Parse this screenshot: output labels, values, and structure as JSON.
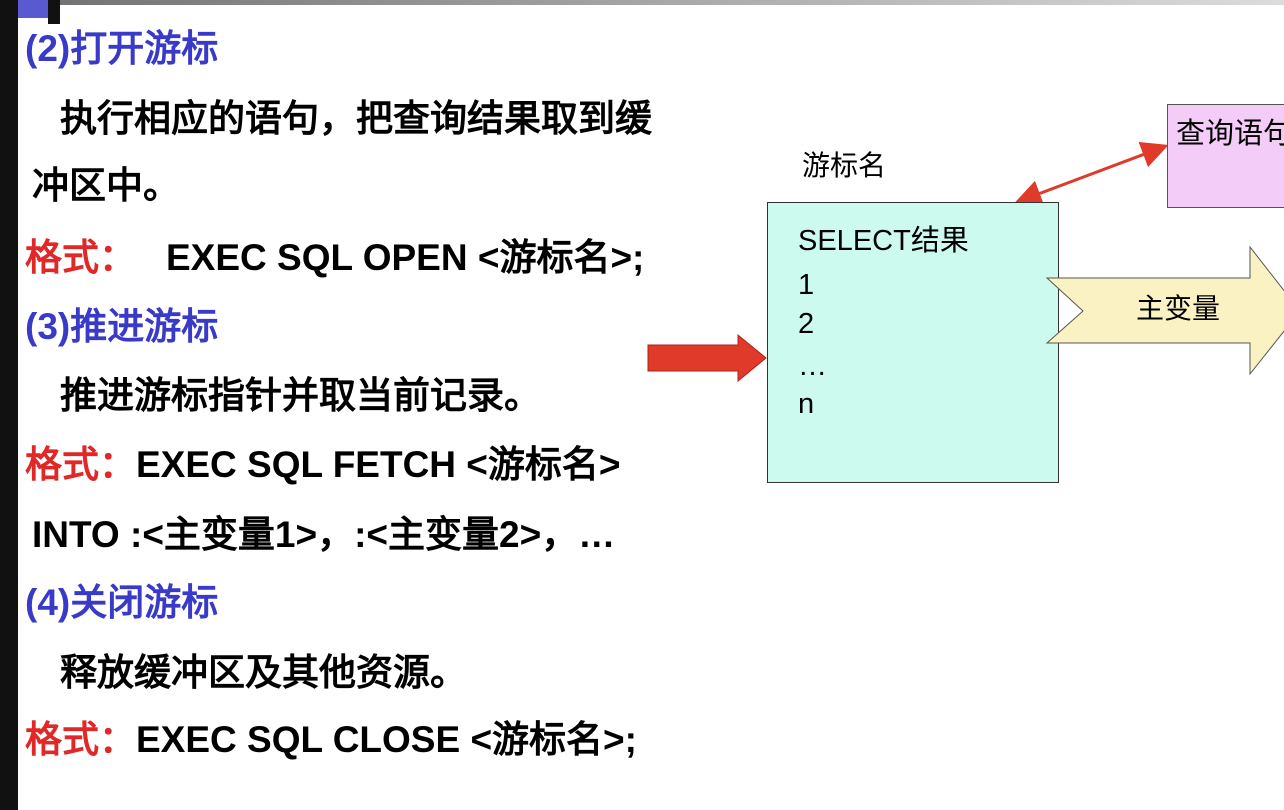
{
  "sections": [
    {
      "heading": "(2)打开游标",
      "desc_line1": "执行相应的语句，把查询结果取到缓",
      "desc_line2": "冲区中。",
      "format_label": "格式：",
      "format_code": "EXEC SQL OPEN <游标名>;"
    },
    {
      "heading": "(3)推进游标",
      "desc": "推进游标指针并取当前记录。",
      "format_label": "格式：",
      "format_code": "EXEC SQL FETCH <游标名>",
      "format_code_2": "INTO :<主变量1>，:<主变量2>，…"
    },
    {
      "heading": "(4)关闭游标",
      "desc": "释放缓冲区及其他资源。",
      "format_label": "格式：",
      "format_code": "EXEC SQL CLOSE <游标名>;"
    }
  ],
  "diagram": {
    "cursor_label": "游标名",
    "result_title": "SELECT结果",
    "rows": [
      "1",
      "2",
      "…",
      "n"
    ],
    "query_label": "查询语句",
    "host_var_label": "主变量"
  },
  "colors": {
    "heading": "#3a3ac8",
    "format_label": "#e02828",
    "result_box": "#ccfaee",
    "query_box": "#f4ccf8",
    "host_arrow": "#fbf2c4",
    "pointer_arrow": "#e03a2a"
  }
}
